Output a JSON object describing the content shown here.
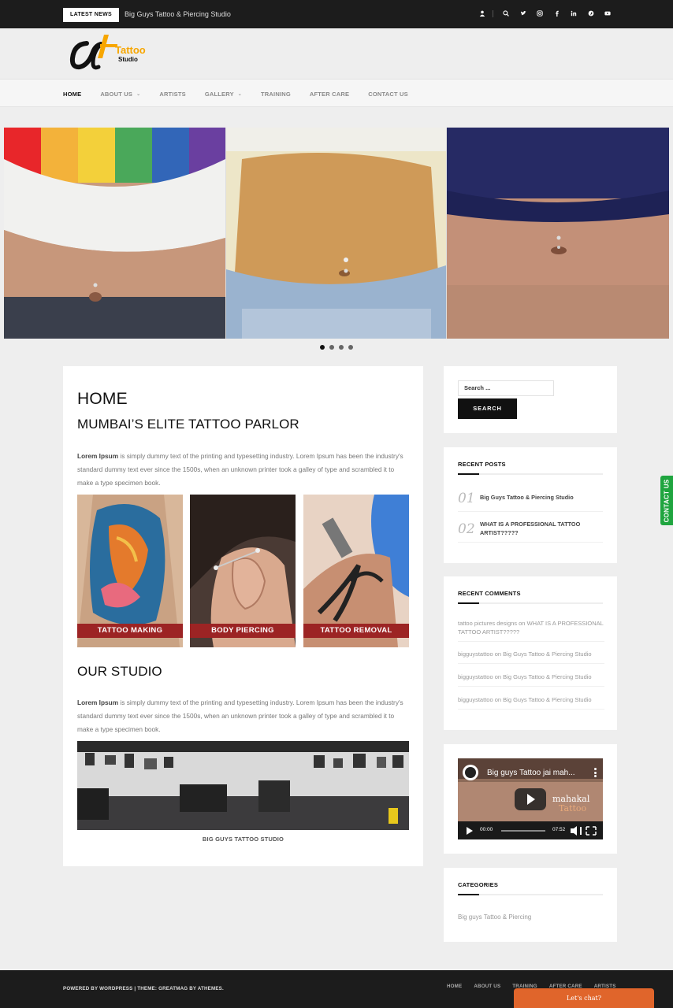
{
  "topbar": {
    "latest_label": "LATEST NEWS",
    "latest_text": "Big Guys Tattoo & Piercing Studio",
    "social_icons": [
      "user-icon",
      "search-icon",
      "twitter-icon",
      "instagram-icon",
      "facebook-icon",
      "linkedin-icon",
      "pinterest-icon",
      "youtube-icon"
    ]
  },
  "logo": {
    "word1": "Tattoo",
    "word2": "Studio",
    "accent": "#f7a600"
  },
  "nav": {
    "items": [
      {
        "label": "HOME",
        "active": true
      },
      {
        "label": "ABOUT US",
        "dropdown": true
      },
      {
        "label": "ARTISTS"
      },
      {
        "label": "GALLERY",
        "dropdown": true
      },
      {
        "label": "TRAINING"
      },
      {
        "label": "AFTER CARE"
      },
      {
        "label": "CONTACT US"
      }
    ]
  },
  "slider": {
    "dots": 4,
    "active": 1
  },
  "main": {
    "title": "HOME",
    "subtitle": "MUMBAI’S ELITE TATTOO PARLOR",
    "intro_bold": "Lorem Ipsum",
    "intro_text": " is simply dummy text of the printing and typesetting industry. Lorem Ipsum has been the industry's standard dummy text ever since the 1500s, when an unknown printer took a galley of type and scrambled it to make a type specimen book.",
    "services": [
      "TATTOO MAKING",
      "BODY PIERCING",
      "TATTOO REMOVAL"
    ],
    "studio_heading": "OUR STUDIO",
    "studio_bold": "Lorem Ipsum",
    "studio_text": " is simply dummy text of the printing and typesetting industry. Lorem Ipsum has been the industry's standard dummy text ever since the 1500s, when an unknown printer took a galley of type and scrambled it to make a type specimen book.",
    "studio_caption": "BIG GUYS TATTOO STUDIO"
  },
  "sidebar": {
    "search_placeholder": "Search ...",
    "search_button": "SEARCH",
    "recent_posts_title": "RECENT POSTS",
    "recent_posts": [
      {
        "num": "01",
        "title": "Big Guys Tattoo & Piercing Studio"
      },
      {
        "num": "02",
        "title": "WHAT IS A PROFESSIONAL TATTOO ARTIST?????"
      }
    ],
    "recent_comments_title": "RECENT COMMENTS",
    "comments": [
      {
        "author": "tattoo pictures designs",
        "on": "on",
        "post": "WHAT IS A PROFESSIONAL TATTOO ARTIST?????"
      },
      {
        "author": "bigguystattoo",
        "on": "on",
        "post": "Big Guys Tattoo & Piercing Studio"
      },
      {
        "author": "bigguystattoo",
        "on": "on",
        "post": "Big Guys Tattoo & Piercing Studio"
      },
      {
        "author": "bigguystattoo",
        "on": "on",
        "post": "Big Guys Tattoo & Piercing Studio"
      }
    ],
    "video": {
      "title": "Big guys Tattoo jai mah...",
      "overlay_line1": "mahakal",
      "overlay_line2": "Tattoo",
      "time_current": "00:00",
      "time_total": "07:52"
    },
    "categories_title": "CATEGORIES",
    "category": "Big guys Tattoo & Piercing"
  },
  "contact_tab": "CONTACT US",
  "footer": {
    "credits": "POWERED BY WORDPRESS | THEME: GREATMAG BY ATHEMES.",
    "nav": [
      "HOME",
      "ABOUT US",
      "TRAINING",
      "AFTER CARE",
      "ARTISTS"
    ]
  },
  "chat": "Let's chat?"
}
